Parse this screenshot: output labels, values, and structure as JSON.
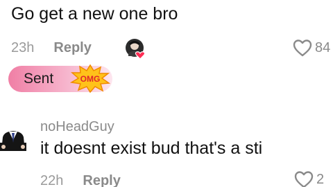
{
  "top_comment": {
    "text": "Go get a new one bro",
    "time": "23h",
    "reply_label": "Reply",
    "like_count": "84",
    "reply_status": "Sent",
    "sticker_text": "OMG"
  },
  "bottom_comment": {
    "author": "noHeadGuy",
    "text": "it doesnt exist bud that's a sti",
    "time": "22h",
    "reply_label": "Reply",
    "like_count": "2"
  },
  "colors": {
    "sent_pill_start": "#f07fa5",
    "sent_pill_end": "#fde6ef",
    "creator_badge": "#ff2d55",
    "sticker_fill": "#ffc21a"
  },
  "icons": [
    "heart-outline-icon",
    "creator-avatar",
    "omg-sticker",
    "author-avatar"
  ]
}
